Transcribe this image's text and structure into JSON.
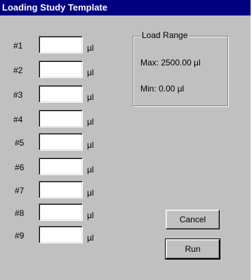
{
  "window": {
    "title": "Loading Study Template"
  },
  "rows": [
    {
      "label": "#1",
      "value": "",
      "unit": "µl"
    },
    {
      "label": "#2",
      "value": "",
      "unit": "µl"
    },
    {
      "label": "#3",
      "value": "",
      "unit": "µl"
    },
    {
      "label": "#4",
      "value": "",
      "unit": "µl"
    },
    {
      "label": "#5",
      "value": "",
      "unit": "µl"
    },
    {
      "label": "#6",
      "value": "",
      "unit": "µl"
    },
    {
      "label": "#7",
      "value": "",
      "unit": "µl"
    },
    {
      "label": "#8",
      "value": "",
      "unit": "µl"
    },
    {
      "label": "#9",
      "value": "",
      "unit": "µl"
    }
  ],
  "load_range": {
    "legend": "Load Range",
    "max": "Max: 2500.00 µl",
    "min": "Min: 0.00 µl"
  },
  "buttons": {
    "cancel": "Cancel",
    "run": "Run"
  },
  "colors": {
    "titlebar": "#000080",
    "face": "#c0c0c0"
  }
}
